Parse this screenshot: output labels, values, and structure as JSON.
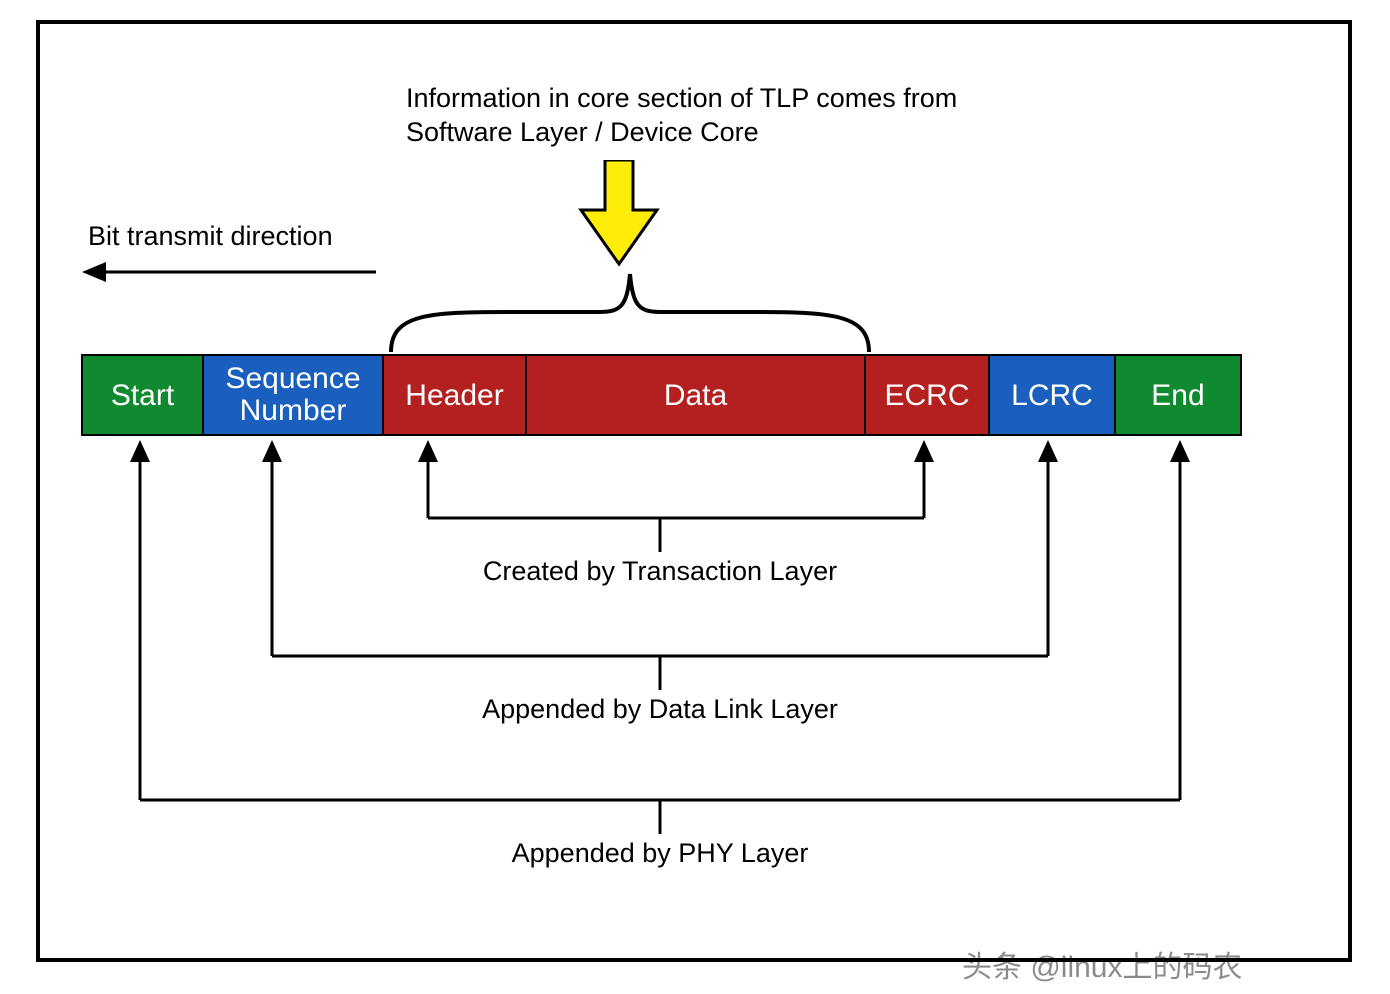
{
  "topCaption": "Information in core section of TLP comes from Software Layer / Device Core",
  "bitDir": "Bit transmit direction",
  "segments": {
    "start": "Start",
    "seq1": "Sequence",
    "seq2": "Number",
    "header": "Header",
    "data": "Data",
    "ecrc": "ECRC",
    "lcrc": "LCRC",
    "end": "End"
  },
  "layers": {
    "transaction": "Created by Transaction Layer",
    "datalink": "Appended by Data Link Layer",
    "phy": "Appended by PHY Layer"
  },
  "watermark": "头条 @linux上的码农"
}
